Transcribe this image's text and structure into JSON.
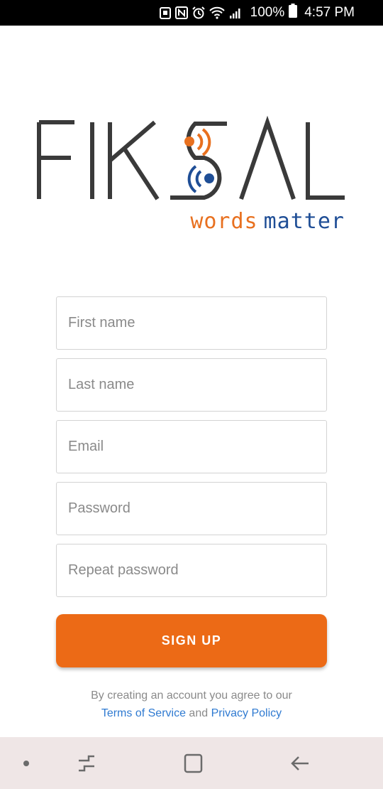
{
  "status_bar": {
    "battery_text": "100%",
    "time": "4:57 PM"
  },
  "logo": {
    "name": "FIKSAL",
    "tagline_part1": "words",
    "tagline_part2": "matter",
    "colors": {
      "dark": "#3a3a3a",
      "orange": "#e8701f",
      "blue": "#1f4e96"
    }
  },
  "form": {
    "first_name_placeholder": "First name",
    "last_name_placeholder": "Last name",
    "email_placeholder": "Email",
    "password_placeholder": "Password",
    "repeat_password_placeholder": "Repeat password"
  },
  "signup_button": {
    "label": "SIGN UP",
    "color": "#ec6a16"
  },
  "legal": {
    "prefix": "By creating an account you agree to our",
    "terms_link": "Terms of Service",
    "conjunction": "and",
    "privacy_link": "Privacy Policy",
    "link_color": "#2f7ad1"
  },
  "nav_bar": {
    "icons": [
      "dot-indicator-icon",
      "recent-apps-icon",
      "home-icon",
      "back-icon"
    ]
  }
}
